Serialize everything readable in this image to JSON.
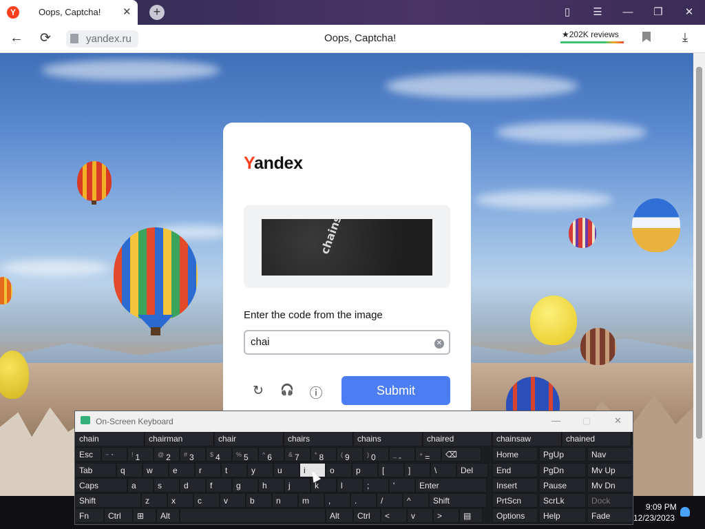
{
  "browser": {
    "tab_title": "Oops, Captcha!",
    "tab_logo": "Y",
    "tab_close": "✕",
    "new_tab": "+",
    "url": "yandex.ru",
    "page_title": "Oops, Captcha!",
    "reviews": "★202K reviews",
    "window_controls": {
      "collections": "▯",
      "menu": "☰",
      "minimize": "—",
      "restore": "❐",
      "close": "✕"
    },
    "icons": {
      "back": "←",
      "reload": "⟳",
      "download": "⤓"
    }
  },
  "captcha": {
    "logo_first": "Y",
    "logo_rest": "andex",
    "image_text": "chains girth",
    "prompt": "Enter the code from the image",
    "input_value": "chai",
    "clear_icon": "✕",
    "refresh_icon": "↻",
    "audio_icon": "🎧",
    "info_icon": "ⓘ",
    "submit_label": "Submit"
  },
  "osk": {
    "title": "On-Screen Keyboard",
    "suggestions": [
      "chain",
      "chairman",
      "chair",
      "chairs",
      "chains",
      "chaired",
      "chainsaw",
      "chained"
    ],
    "row1": [
      {
        "t": "Esc"
      },
      {
        "s": "~",
        "t": "`"
      },
      {
        "s": "!",
        "t": "1"
      },
      {
        "s": "@",
        "t": "2"
      },
      {
        "s": "#",
        "t": "3"
      },
      {
        "s": "$",
        "t": "4"
      },
      {
        "s": "%",
        "t": "5"
      },
      {
        "s": "^",
        "t": "6"
      },
      {
        "s": "&",
        "t": "7"
      },
      {
        "s": "*",
        "t": "8"
      },
      {
        "s": "(",
        "t": "9"
      },
      {
        "s": ")",
        "t": "0"
      },
      {
        "s": "_",
        "t": "-"
      },
      {
        "s": "+",
        "t": "="
      },
      {
        "t": "⌫"
      }
    ],
    "row2": [
      "Tab",
      "q",
      "w",
      "e",
      "r",
      "t",
      "y",
      "u",
      "i",
      "o",
      "p",
      "[",
      "]",
      "\\",
      "Del"
    ],
    "row3": [
      "Caps",
      "a",
      "s",
      "d",
      "f",
      "g",
      "h",
      "j",
      "k",
      "l",
      ";",
      "'",
      "Enter"
    ],
    "row4": [
      "Shift",
      "z",
      "x",
      "c",
      "v",
      "b",
      "n",
      "m",
      ",",
      ".",
      "/",
      "^",
      "Shift"
    ],
    "row5": [
      "Fn",
      "Ctrl",
      "⊞",
      "Alt",
      "",
      "Alt",
      "Ctrl",
      "<",
      "v",
      ">",
      "▤"
    ],
    "nav": [
      [
        "Home",
        "PgUp",
        "Nav"
      ],
      [
        "End",
        "PgDn",
        "Mv Up"
      ],
      [
        "Insert",
        "Pause",
        "Mv Dn"
      ],
      [
        "PrtScn",
        "ScrLk",
        "Dock"
      ],
      [
        "Options",
        "Help",
        "Fade"
      ]
    ]
  },
  "taskbar": {
    "time": "9:09 PM",
    "date": "12/23/2023"
  },
  "colors": {
    "yandex_red": "#fc3f1d",
    "submit_blue": "#4c7df2"
  }
}
